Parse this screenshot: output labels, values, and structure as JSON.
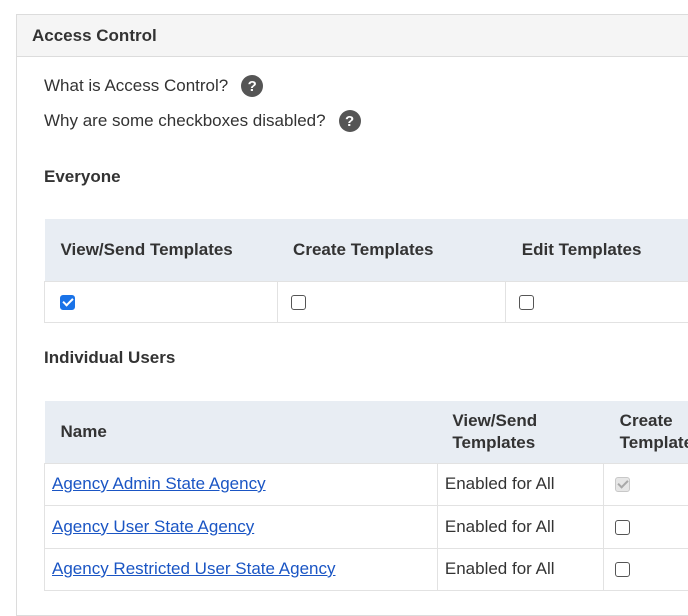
{
  "panel": {
    "title": "Access Control"
  },
  "help": [
    {
      "text": "What is Access Control?"
    },
    {
      "text": "Why are some checkboxes disabled?"
    }
  ],
  "everyone": {
    "title": "Everyone",
    "headers": [
      "View/Send Templates",
      "Create Templates",
      "Edit Templates"
    ],
    "checkboxes": [
      {
        "checked": true,
        "disabled": false
      },
      {
        "checked": false,
        "disabled": false
      },
      {
        "checked": false,
        "disabled": false
      }
    ]
  },
  "individual": {
    "title": "Individual Users",
    "headers": {
      "name": "Name",
      "view_send": "View/Send Templates",
      "create": "Create Templates"
    },
    "rows": [
      {
        "name": "Agency Admin State Agency",
        "view_send": "Enabled for All",
        "create_checked": true,
        "create_disabled": true
      },
      {
        "name": "Agency User State Agency",
        "view_send": "Enabled for All",
        "create_checked": false,
        "create_disabled": false
      },
      {
        "name": "Agency Restricted User State Agency",
        "view_send": "Enabled for All",
        "create_checked": false,
        "create_disabled": false
      }
    ]
  }
}
